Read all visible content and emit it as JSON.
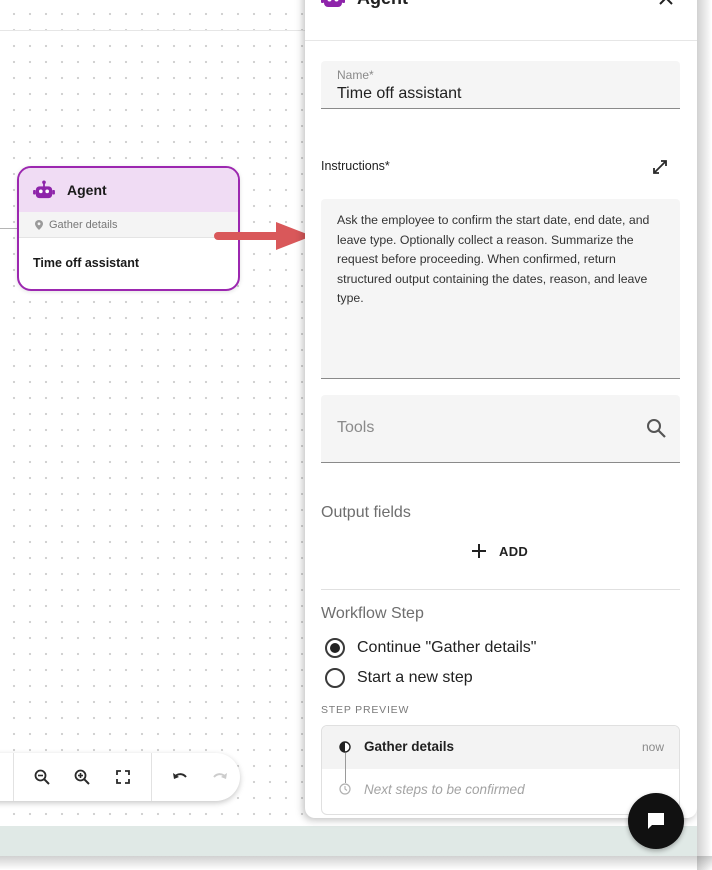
{
  "node": {
    "title": "Agent",
    "step": "Gather details",
    "name": "Time off assistant",
    "icon": "robot-icon",
    "accent": "#9c27b0"
  },
  "toolbar": {
    "icons": [
      "zoom-out-icon",
      "zoom-in-icon",
      "fit-view-icon",
      "undo-icon",
      "redo-icon"
    ]
  },
  "panel": {
    "title": "Agent",
    "name_field": {
      "label": "Name*",
      "value": "Time off assistant"
    },
    "instructions": {
      "label": "Instructions*",
      "value": "Ask the employee to confirm the start date, end date, and leave type. Optionally collect a reason. Summarize the request before proceeding. When confirmed, return structured output containing the dates, reason, and leave type."
    },
    "tools": {
      "placeholder": "Tools"
    },
    "output_fields": {
      "label": "Output fields",
      "add_label": "ADD"
    },
    "workflow_step": {
      "label": "Workflow Step",
      "options": [
        {
          "label": "Continue \"Gather details\"",
          "selected": true
        },
        {
          "label": "Start a new step",
          "selected": false
        }
      ]
    },
    "step_preview": {
      "label": "STEP PREVIEW",
      "current": {
        "title": "Gather details",
        "time": "now"
      },
      "next": "Next steps to be confirmed"
    }
  }
}
